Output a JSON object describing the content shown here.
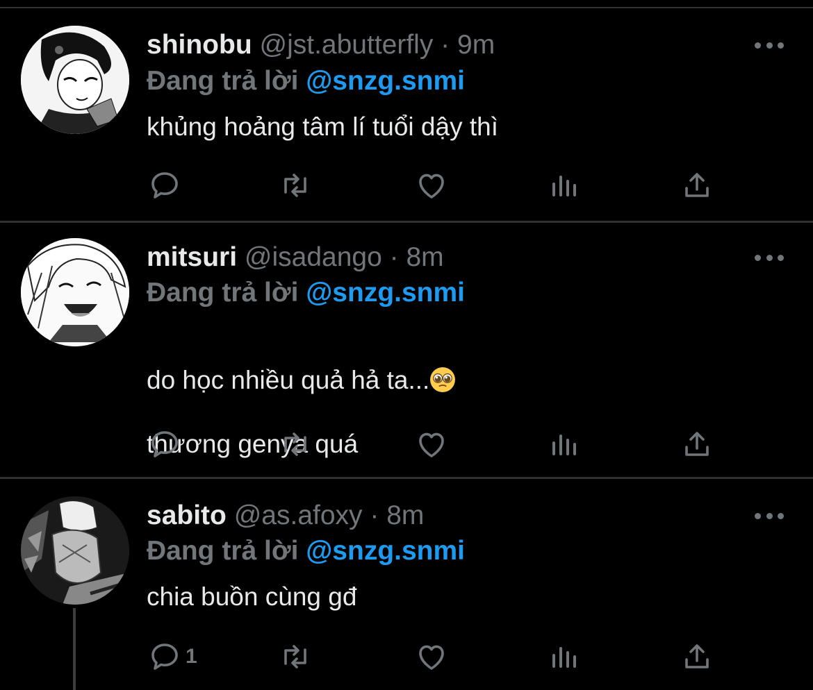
{
  "tweets": [
    {
      "name": "shinobu",
      "handle": "@jst.abutterfly",
      "separator": "·",
      "time": "9m",
      "reply_prefix": "Đang trả lời",
      "reply_to": "@snzg.snmi",
      "text": "khủng hoảng tâm lí tuổi dậy thì",
      "reply_count": ""
    },
    {
      "name": "mitsuri",
      "handle": "@isadango",
      "separator": "·",
      "time": "8m",
      "reply_prefix": "Đang trả lời",
      "reply_to": "@snzg.snmi",
      "text_line1": "do học nhiều quả hả ta...",
      "emoji": "pleading-face",
      "text_line2": "thương genya quá",
      "reply_count": ""
    },
    {
      "name": "sabito",
      "handle": "@as.afoxy",
      "separator": "·",
      "time": "8m",
      "reply_prefix": "Đang trả lời",
      "reply_to": "@snzg.snmi",
      "text": "chia buồn cùng gđ",
      "reply_count": "1"
    }
  ],
  "icons": [
    "reply-icon",
    "retweet-icon",
    "like-icon",
    "analytics-icon",
    "share-icon",
    "more-icon"
  ],
  "colors": {
    "background": "#000000",
    "mention": "#1d9bf0",
    "muted": "#71767b",
    "text": "#e7e9ea",
    "divider": "#2f3336"
  }
}
